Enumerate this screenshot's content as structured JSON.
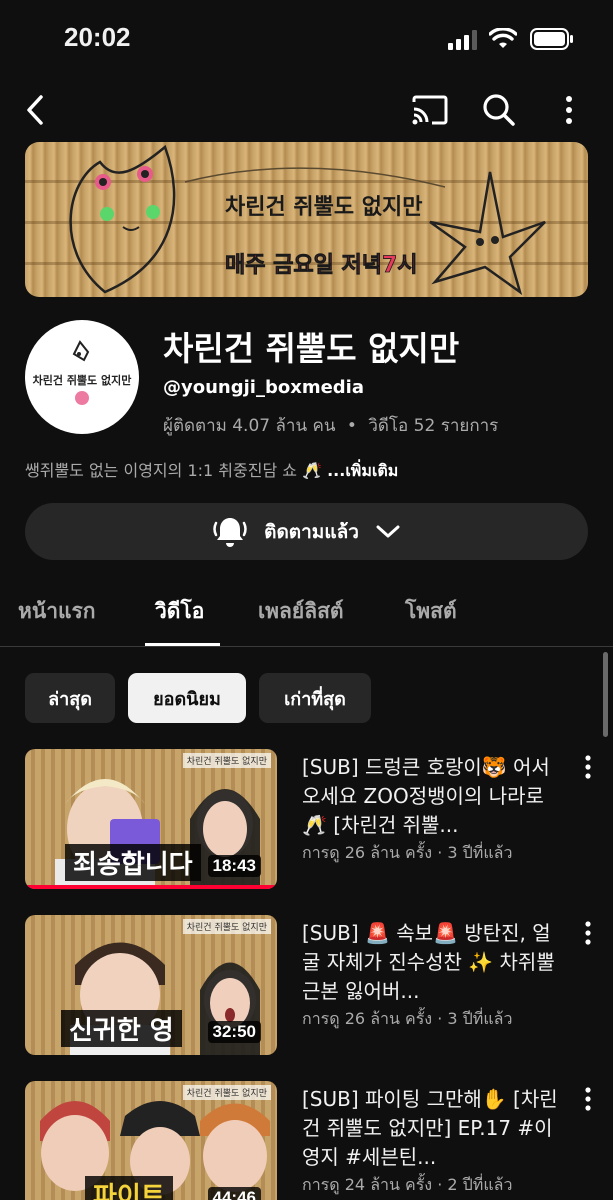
{
  "status_bar": {
    "time": "20:02"
  },
  "channel": {
    "name": "차린건 쥐뿔도 없지만",
    "handle": "@youngji_boxmedia",
    "subscribers": "ผู้ติดตาม 4.07 ล้าน คน",
    "video_count": "วิดีโอ 52 รายการ",
    "meta_separator": "•",
    "description": "쌩쥐뿔도 없는 이영지의 1:1 취중진담 쇼 🥂",
    "more_label": "...เพิ่มเติม",
    "subscribe_label": "ติดตามแล้ว",
    "banner_text_top": "차린건 쥐뿔도 없지만",
    "banner_text_bottom": "매주 금요일 저녁7시",
    "avatar_text": "차린건 쥐뿔도 없지만"
  },
  "tabs": [
    {
      "label": "หน้าแรก",
      "active": false
    },
    {
      "label": "วิดีโอ",
      "active": true
    },
    {
      "label": "เพลย์ลิสต์",
      "active": false
    },
    {
      "label": "โพสต์",
      "active": false
    }
  ],
  "chips": [
    {
      "label": "ล่าสุด",
      "selected": false
    },
    {
      "label": "ยอดนิยม",
      "selected": true
    },
    {
      "label": "เก่าที่สุด",
      "selected": false
    }
  ],
  "videos": [
    {
      "title": "[SUB] 드렁큰 호랑이🐯 어서오세요 ZOO정뱅이의 나라로🥂 [차린건 쥐뿔...",
      "meta": "การดู 26 ล้าน ครั้ง · 3 ปีที่แล้ว",
      "duration": "18:43",
      "caption": "죄송합니다",
      "watched_fraction": 1.0
    },
    {
      "title": "[SUB] 🚨 속보🚨 방탄진, 얼굴 자체가 진수성찬 ✨ 차쥐뿔 근본 잃어버...",
      "meta": "การดู 26 ล้าน ครั้ง · 3 ปีที่แล้ว",
      "duration": "32:50",
      "caption": "신귀한 영"
    },
    {
      "title": "[SUB] 파이팅 그만해✋ [차린건 쥐뿔도 없지만] EP.17 #이영지 #세븐틴...",
      "meta": "การดู 24 ล้าน ครั้ง · 2 ปีที่แล้ว",
      "duration": "44:46",
      "caption": "파이트"
    }
  ],
  "colors": {
    "background": "#0f0f0f",
    "surface": "#272727",
    "progress": "#ff0033",
    "text_secondary": "#aaaaaa"
  },
  "icons": [
    "back-icon",
    "cast-icon",
    "search-icon",
    "more-vert-icon",
    "bell-icon",
    "chevron-down-icon"
  ]
}
